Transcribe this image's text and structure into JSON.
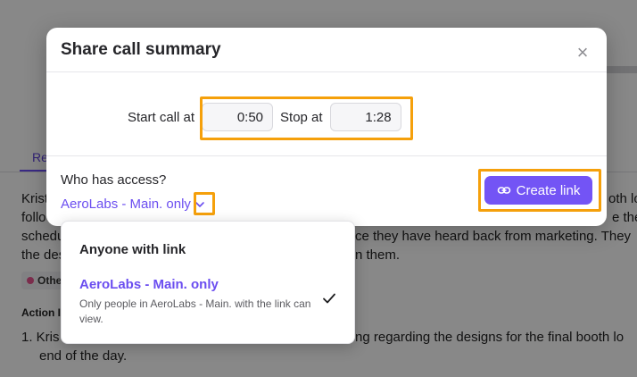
{
  "background": {
    "tab_label": "Re",
    "lines": [
      "Krist",
      "follo",
      "schedu",
      "the des",
      "oth lo",
      "e the",
      "ce they have heard back from marketing. They",
      "n them."
    ],
    "tag_label": "Othe",
    "section_heading": "Action I",
    "list_item_1_start": "1.  Kris",
    "list_item_1_end": "ng regarding the designs for the final booth lo",
    "list_item_1_cont": "end of the day."
  },
  "modal": {
    "title": "Share call summary",
    "close_icon": "close-icon",
    "start_label": "Start call at",
    "start_value": "0:50",
    "stop_label": "Stop at",
    "stop_value": "1:28",
    "access_label": "Who has access?",
    "access_selected": "AeroLabs - Main. only",
    "create_button_label": "Create link",
    "create_button_icon": "link-icon"
  },
  "dropdown": {
    "options": [
      {
        "label": "Anyone with link"
      },
      {
        "label": "AeroLabs - Main. only",
        "description": "Only people in AeroLabs - Main. with the link can view."
      }
    ]
  },
  "colors": {
    "accent": "#7354f5",
    "highlight": "#f5a00b",
    "overlay": "rgba(0,0,0,0.45)"
  }
}
